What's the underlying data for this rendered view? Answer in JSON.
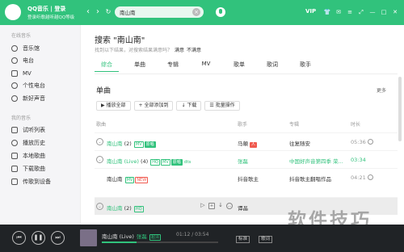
{
  "app": {
    "title": "QQ音乐 | 登录",
    "subtitle": "登录听歌越听越QQ等级",
    "brand_color": "#31c27c"
  },
  "search": {
    "value": "南山南"
  },
  "top_right": {
    "vip": "VIP",
    "icons": [
      "shirt-icon",
      "mail-icon",
      "settings-icon",
      "mini-mode-icon",
      "minimize-icon",
      "maximize-icon",
      "close-icon"
    ]
  },
  "sidebar": {
    "group_online": "在线音乐",
    "online_items": [
      {
        "label": "音乐馆",
        "icon": "music-hall-icon"
      },
      {
        "label": "电台",
        "icon": "radio-icon"
      },
      {
        "label": "MV",
        "icon": "mv-icon"
      },
      {
        "label": "个性电台",
        "icon": "personal-radio-icon"
      },
      {
        "label": "新好声音",
        "icon": "voice-icon"
      }
    ],
    "group_mine": "我的音乐",
    "mine_items": [
      {
        "label": "试听列表",
        "icon": "playlist-icon"
      },
      {
        "label": "播放历史",
        "icon": "history-icon"
      },
      {
        "label": "本地歌曲",
        "icon": "local-icon"
      },
      {
        "label": "下载歌曲",
        "icon": "download-icon"
      },
      {
        "label": "传歌到设备",
        "icon": "device-icon"
      }
    ]
  },
  "main": {
    "search_title": "搜索 \"南山南\"",
    "hint": "找到以下结果，对搜索结果满意吗？",
    "hint_yes": "满意",
    "hint_no": "不满意",
    "tabs": [
      "综合",
      "单曲",
      "专辑",
      "MV",
      "歌单",
      "歌词",
      "歌手"
    ],
    "active_tab": 0,
    "section_title": "单曲",
    "more": "更多",
    "actions": [
      "▶ 播放全部",
      "+ 全部添加到",
      "↓ 下载",
      "☰ 批量操作"
    ],
    "columns": {
      "song": "歌曲",
      "artist": "歌手",
      "album": "专辑",
      "duration": "时长"
    },
    "songs": [
      {
        "title": "南山南",
        "count": "(2)",
        "badges": [
          "MV",
          "原唱"
        ],
        "artist": "马頔",
        "artist_tag": "人",
        "album": "往复随安",
        "duration": "05:36",
        "green": true,
        "expand": true
      },
      {
        "title": "南山南 (Live)",
        "count": "(4)",
        "badges": [
          "HQ",
          "MV",
          "原唱"
        ],
        "extra": "dts",
        "artist": "张磊",
        "artist_tag": "",
        "album": "中国好声音第四季 荣...",
        "duration": "03:34",
        "green": true,
        "green_meta": true,
        "expand": true
      },
      {
        "title": "南山南",
        "count": "",
        "badges": [
          "MV",
          "NEW"
        ],
        "artist": "抖音歌主",
        "artist_tag": "",
        "album": "抖音歌主翻唱作品",
        "duration": "04:21",
        "green": false,
        "expand": false
      },
      {
        "title": "南山南",
        "count": "(2)",
        "badges": [
          "HQ"
        ],
        "artist": "谭晶",
        "artist_tag": "",
        "album": "",
        "duration": "",
        "green": true,
        "hover": true,
        "expand": true
      }
    ]
  },
  "player": {
    "now_title": "南山南 (Live)",
    "now_artist": "张磊",
    "quality_badge": "超清",
    "time": "01:12 / 03:54",
    "progress": 0.3,
    "quality": "标准",
    "lyrics": "歌词"
  },
  "watermark": "软件技巧"
}
